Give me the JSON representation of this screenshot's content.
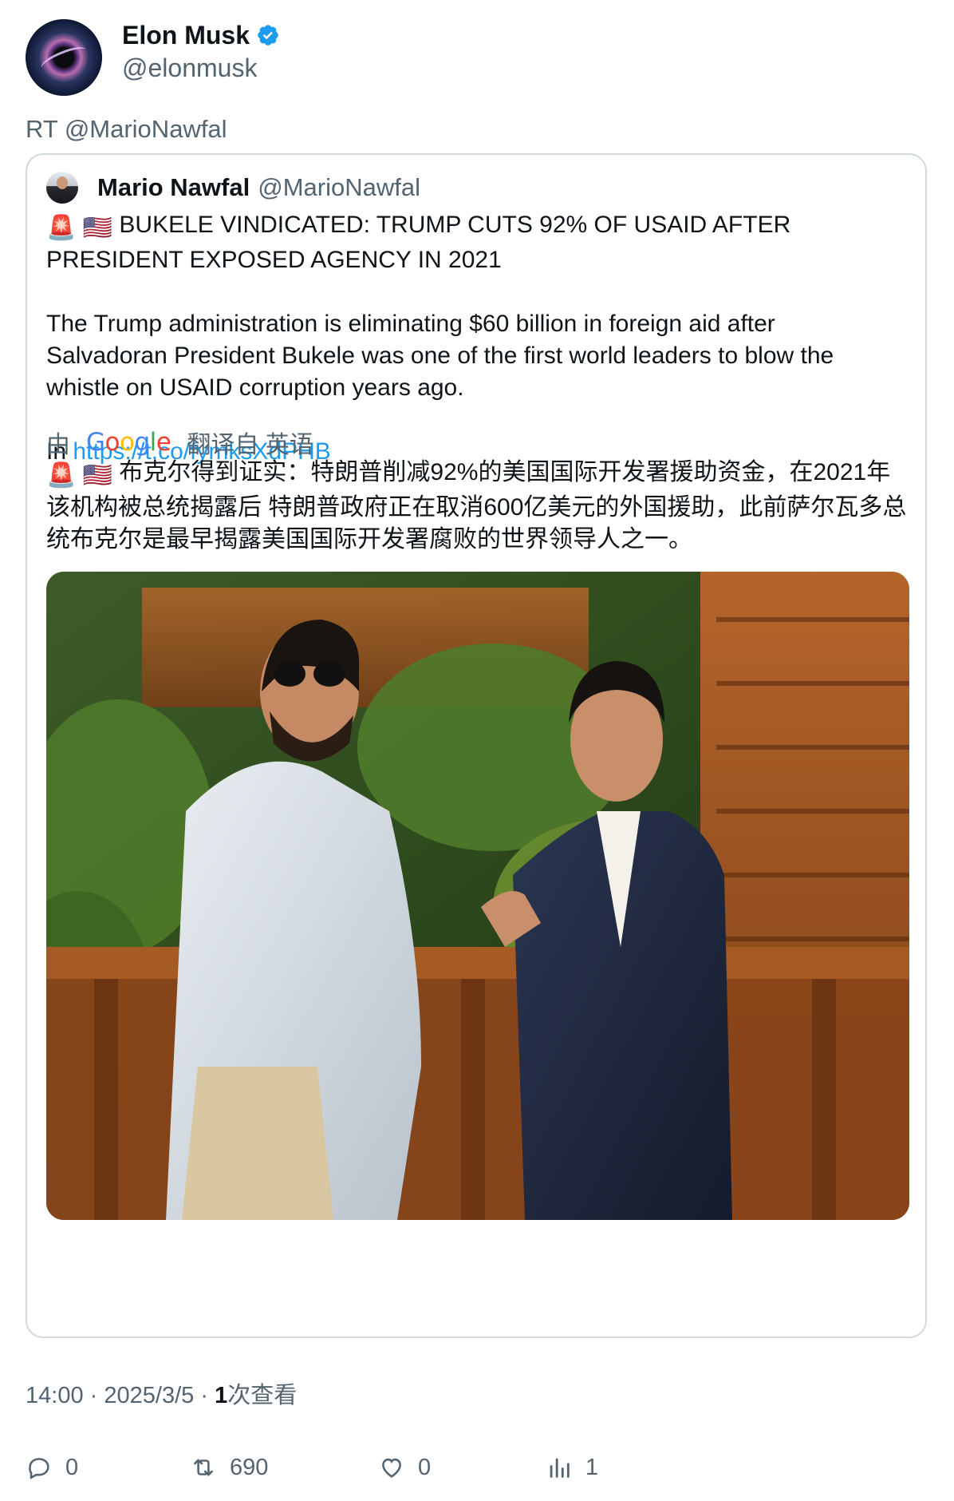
{
  "author": {
    "display_name": "Elon Musk",
    "handle": "@elonmusk",
    "verified_icon": "verified-badge-icon"
  },
  "retweet_label": "RT @MarioNawfal",
  "quoted": {
    "display_name": "Mario Nawfal",
    "handle": "@MarioNawfal",
    "headline": "BUKELE VINDICATED: TRUMP CUTS 92% OF USAID AFTER PRESIDENT EXPOSED AGENCY IN 2021",
    "body": "The Trump administration is eliminating $60 billion in foreign aid after Salvadoran President Bukele was one of the first world leaders to blow the whistle on USAID corruption years ago.",
    "link_prefix": "In",
    "link": "https://t.co/fymksXdPHB",
    "emoji_siren": "🚨",
    "emoji_flag": "🇺🇸"
  },
  "translation": {
    "by": "由",
    "provider": "Google",
    "from": "翻译自 英语",
    "text": "布克尔得到证实：特朗普削减92%的美国国际开发署援助资金，在2021年该机构被总统揭露后 特朗普政府正在取消600亿美元的外国援助，此前萨尔瓦多总统布克尔是最早揭露美国国际开发署腐败的世界领导人之一。"
  },
  "meta": {
    "time": "14:00",
    "date": "2025/3/5",
    "separator": "·",
    "views_count": "1",
    "views_label": "次查看"
  },
  "actions": {
    "replies": "0",
    "retweets": "690",
    "likes": "0",
    "views": "1"
  },
  "colors": {
    "link": "#1d9bf0",
    "secondary_text": "#536471",
    "border": "#cfd9de",
    "verified": "#1d9bf0"
  }
}
